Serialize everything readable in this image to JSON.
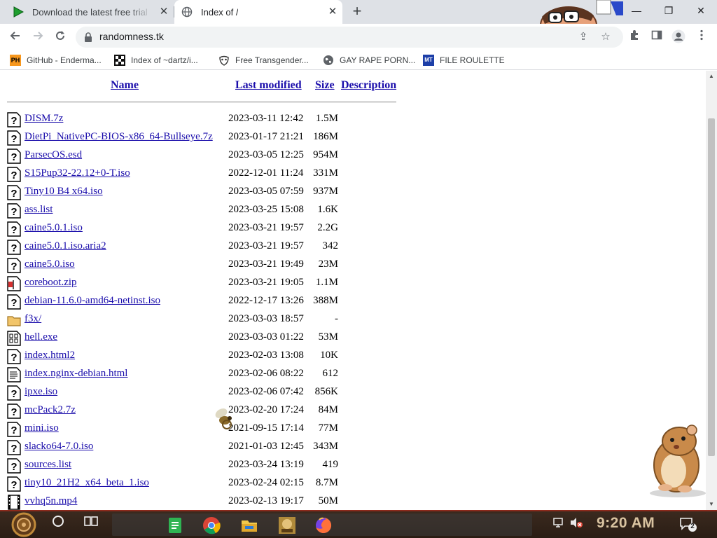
{
  "browser": {
    "tabs": [
      {
        "title": "Download the latest free trial"
      },
      {
        "title": "Index of /"
      }
    ],
    "new_tab_symbol": "+",
    "window_controls": {
      "minimize": "—",
      "restore": "❐",
      "close": "✕"
    },
    "url": "randomness.tk",
    "bookmarks": [
      {
        "label": "GitHub - Enderma...",
        "icon": "ph-favicon"
      },
      {
        "label": "Index of ~dartz/i...",
        "icon": "grid-favicon"
      },
      {
        "label": "Free Transgender...",
        "icon": "mask-favicon"
      },
      {
        "label": "GAY RAPE PORN...",
        "icon": "globe-icon"
      },
      {
        "label": "FILE ROULETTE",
        "icon": "mt-favicon"
      }
    ]
  },
  "listing": {
    "columns": {
      "name": "Name",
      "last_modified": "Last modified",
      "size": "Size",
      "description": "Description"
    },
    "rows": [
      {
        "name": "DISM.7z",
        "modified": "2023-03-11 12:42",
        "size": "1.5M",
        "icon": "unknown"
      },
      {
        "name": "DietPi_NativePC-BIOS-x86_64-Bullseye.7z",
        "modified": "2023-01-17 21:21",
        "size": "186M",
        "icon": "unknown"
      },
      {
        "name": "ParsecOS.esd",
        "modified": "2023-03-05 12:25",
        "size": "954M",
        "icon": "unknown"
      },
      {
        "name": "S15Pup32-22.12+0-T.iso",
        "modified": "2022-12-01 11:24",
        "size": "331M",
        "icon": "unknown"
      },
      {
        "name": "Tiny10 B4 x64.iso",
        "modified": "2023-03-05 07:59",
        "size": "937M",
        "icon": "unknown"
      },
      {
        "name": "ass.list",
        "modified": "2023-03-25 15:08",
        "size": "1.6K",
        "icon": "unknown"
      },
      {
        "name": "caine5.0.1.iso",
        "modified": "2023-03-21 19:57",
        "size": "2.2G",
        "icon": "unknown"
      },
      {
        "name": "caine5.0.1.iso.aria2",
        "modified": "2023-03-21 19:57",
        "size": "342",
        "icon": "unknown"
      },
      {
        "name": "caine5.0.iso",
        "modified": "2023-03-21 19:49",
        "size": "23M",
        "icon": "unknown"
      },
      {
        "name": "coreboot.zip",
        "modified": "2023-03-21 19:05",
        "size": "1.1M",
        "icon": "compressed"
      },
      {
        "name": "debian-11.6.0-amd64-netinst.iso",
        "modified": "2022-12-17 13:26",
        "size": "388M",
        "icon": "unknown"
      },
      {
        "name": "f3x/",
        "modified": "2023-03-03 18:57",
        "size": "-",
        "icon": "folder"
      },
      {
        "name": "hell.exe",
        "modified": "2023-03-03 01:22",
        "size": "53M",
        "icon": "binary"
      },
      {
        "name": "index.html2",
        "modified": "2023-02-03 13:08",
        "size": "10K",
        "icon": "unknown"
      },
      {
        "name": "index.nginx-debian.html",
        "modified": "2023-02-06 08:22",
        "size": "612",
        "icon": "text"
      },
      {
        "name": "ipxe.iso",
        "modified": "2023-02-06 07:42",
        "size": "856K",
        "icon": "unknown"
      },
      {
        "name": "mcPack2.7z",
        "modified": "2023-02-20 17:24",
        "size": "84M",
        "icon": "unknown"
      },
      {
        "name": "mini.iso",
        "modified": "2021-09-15 17:14",
        "size": "77M",
        "icon": "unknown"
      },
      {
        "name": "slacko64-7.0.iso",
        "modified": "2021-01-03 12:45",
        "size": "343M",
        "icon": "unknown"
      },
      {
        "name": "sources.list",
        "modified": "2023-03-24 13:19",
        "size": "419",
        "icon": "unknown"
      },
      {
        "name": "tiny10_21H2_x64_beta_1.iso",
        "modified": "2023-02-24 02:15",
        "size": "8.7M",
        "icon": "unknown"
      },
      {
        "name": "vvhq5n.mp4",
        "modified": "2023-02-13 19:17",
        "size": "50M",
        "icon": "movie"
      }
    ]
  },
  "taskbar": {
    "clock": "9:20 AM",
    "notification_count": "2"
  },
  "colors": {
    "link": "#1a0dab",
    "tab_strip": "#dee1e6",
    "taskbar": "#2a1d14",
    "clock": "#d9c3a0"
  }
}
